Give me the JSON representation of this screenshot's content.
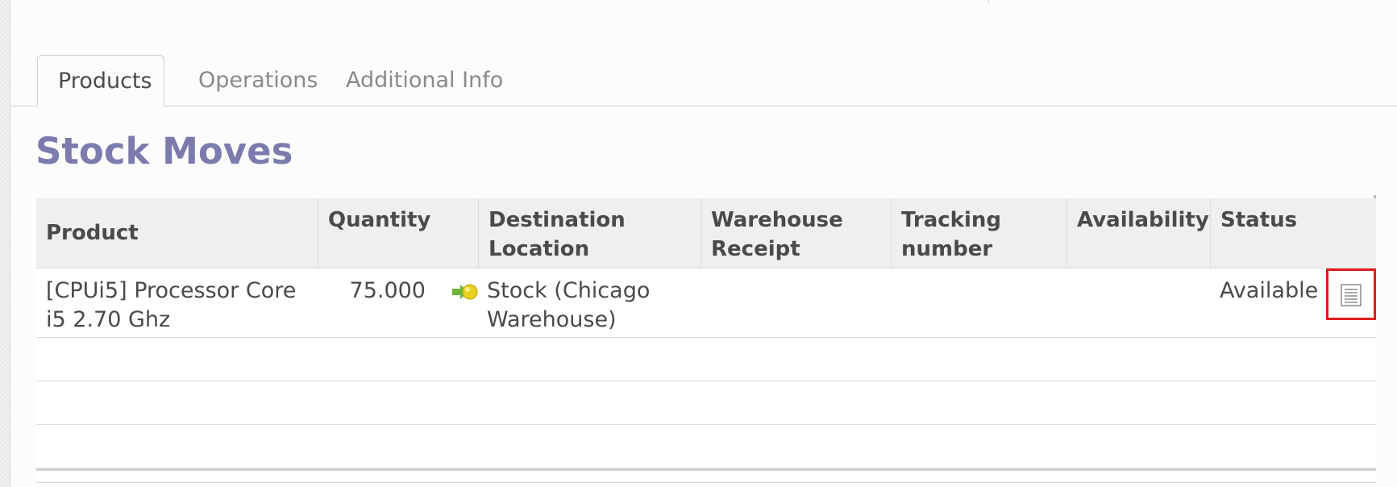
{
  "tabs": [
    {
      "label": "Products",
      "active": true
    },
    {
      "label": "Operations",
      "active": false
    },
    {
      "label": "Additional Info",
      "active": false
    }
  ],
  "section": {
    "title": "Stock Moves"
  },
  "table": {
    "columns": [
      "Product",
      "Quantity",
      "Destination Location",
      "Warehouse Receipt",
      "Tracking number",
      "Availability",
      "Status"
    ],
    "rows": [
      {
        "product": "[CPUi5] Processor Core i5 2.70 Ghz",
        "quantity": "75.000",
        "destination": "Stock (Chicago Warehouse)",
        "warehouse_receipt": "",
        "tracking_number": "",
        "availability": "",
        "status": "Available",
        "move_icon": "green-arrow-yellow-ball-icon",
        "action_icon": "document-icon"
      }
    ]
  },
  "colors": {
    "title": "#7c7bad",
    "highlight": "#e11b1b"
  }
}
